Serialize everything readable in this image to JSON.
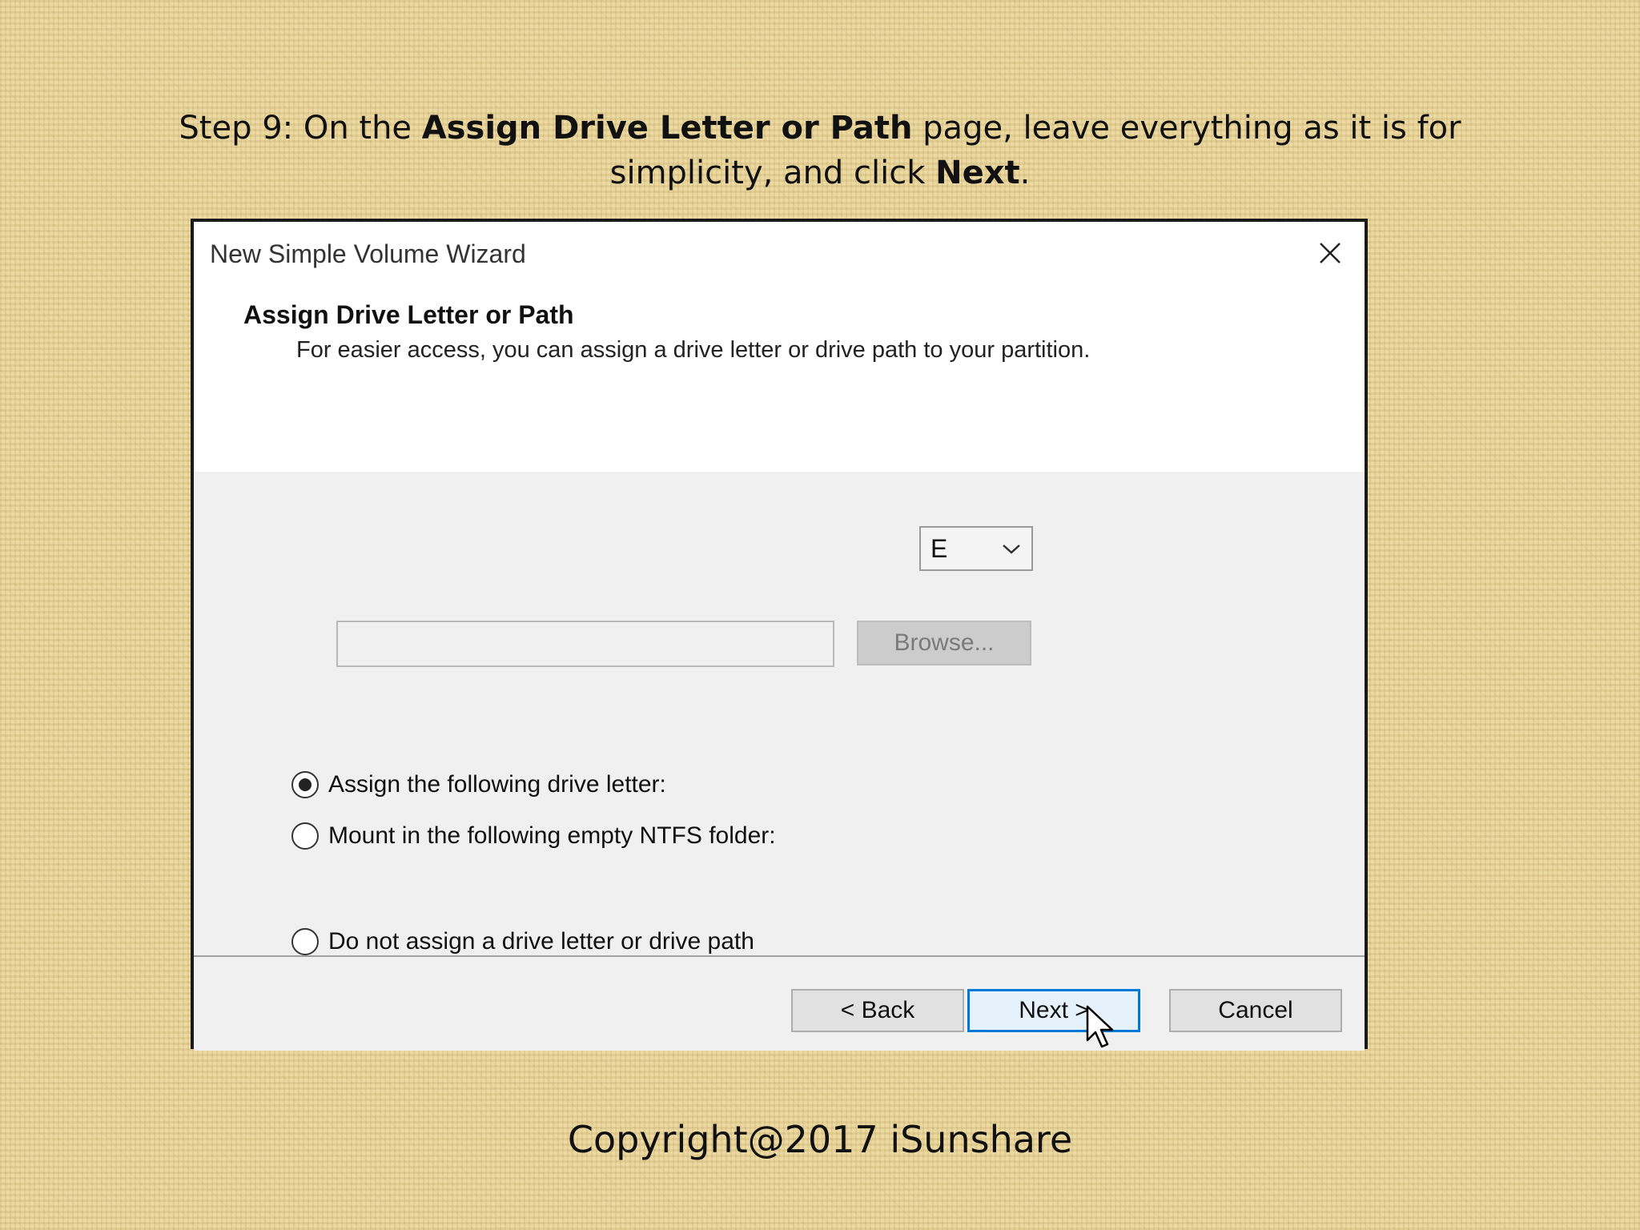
{
  "instruction": {
    "part1": "Step 9: On the ",
    "bold1": "Assign Drive Letter or Path",
    "part2": " page, leave everything as it is for simplicity, and click ",
    "bold2": "Next",
    "part3": "."
  },
  "dialog": {
    "title": "New Simple Volume Wizard",
    "close_icon": "close-icon",
    "header_title": "Assign Drive Letter or Path",
    "header_subtitle": "For easier access, you can assign a drive letter or drive path to your partition.",
    "options": [
      {
        "label": "Assign the following drive letter:",
        "checked": true
      },
      {
        "label": "Mount in the following empty NTFS folder:",
        "checked": false
      },
      {
        "label": "Do not assign a drive letter or drive path",
        "checked": false
      }
    ],
    "drive_letter_value": "E",
    "folder_path_value": "",
    "browse_label": "Browse...",
    "back_label": "< Back",
    "next_label": "Next >",
    "cancel_label": "Cancel"
  },
  "colors": {
    "accent": "#0078d7",
    "background": "#e8d49a"
  },
  "footer": {
    "copyright": "Copyright@2017  iSunshare"
  }
}
